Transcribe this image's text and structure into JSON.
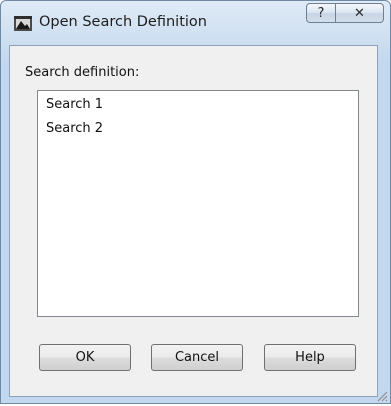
{
  "window": {
    "title": "Open Search Definition",
    "help_button": "?",
    "close_button": "✕"
  },
  "main": {
    "label": "Search definition:",
    "items": [
      "Search 1",
      "Search 2"
    ]
  },
  "buttons": {
    "ok": "OK",
    "cancel": "Cancel",
    "help": "Help"
  },
  "icons": {
    "app": "app-window-icon",
    "help": "help-icon",
    "close": "close-icon",
    "grip": "resize-grip-icon"
  },
  "colors": {
    "titlebar_top": "#dfeaf6",
    "titlebar_bottom": "#c3d7ee",
    "dialog_bg": "#f0f0f0",
    "list_bg": "#ffffff"
  }
}
